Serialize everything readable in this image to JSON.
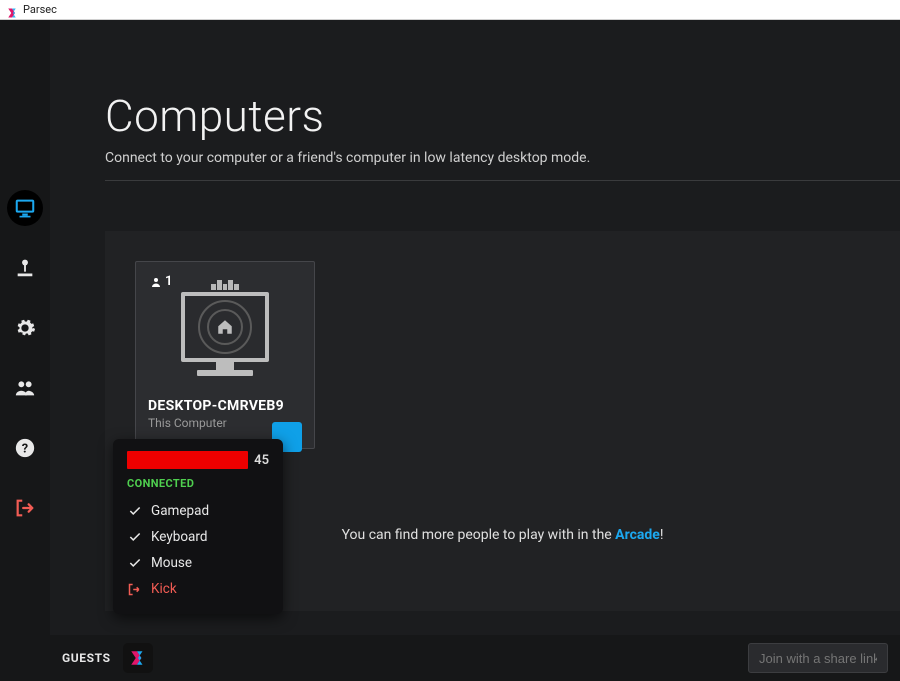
{
  "window": {
    "title": "Parsec"
  },
  "header": {
    "title": "Computers",
    "subtitle": "Connect to your computer or a friend's computer in low latency desktop mode."
  },
  "sidebar": {
    "items": [
      {
        "name": "computers",
        "icon": "monitor-icon",
        "active": true
      },
      {
        "name": "arcade",
        "icon": "joystick-icon",
        "active": false
      },
      {
        "name": "settings",
        "icon": "gear-icon",
        "active": false
      },
      {
        "name": "friends",
        "icon": "users-icon",
        "active": false
      },
      {
        "name": "help",
        "icon": "question-icon",
        "active": false
      },
      {
        "name": "logout",
        "icon": "exit-icon",
        "active": false
      }
    ]
  },
  "computer_card": {
    "guest_count": "1",
    "name": "DESKTOP-CMRVEB9",
    "subtitle": "This Computer"
  },
  "popup": {
    "user_suffix": "45",
    "status": "CONNECTED",
    "items": [
      {
        "label": "Gamepad",
        "checked": true
      },
      {
        "label": "Keyboard",
        "checked": true
      },
      {
        "label": "Mouse",
        "checked": true
      }
    ],
    "kick_label": "Kick"
  },
  "arcade_hint": {
    "prefix": "You can find more people to play with in the ",
    "link": "Arcade",
    "suffix": "!"
  },
  "bottom": {
    "guests_label": "GUESTS",
    "join_placeholder": "Join with a share link o"
  },
  "colors": {
    "accent": "#1ca8f0",
    "danger": "#f25c54",
    "success": "#4fcf4f"
  }
}
